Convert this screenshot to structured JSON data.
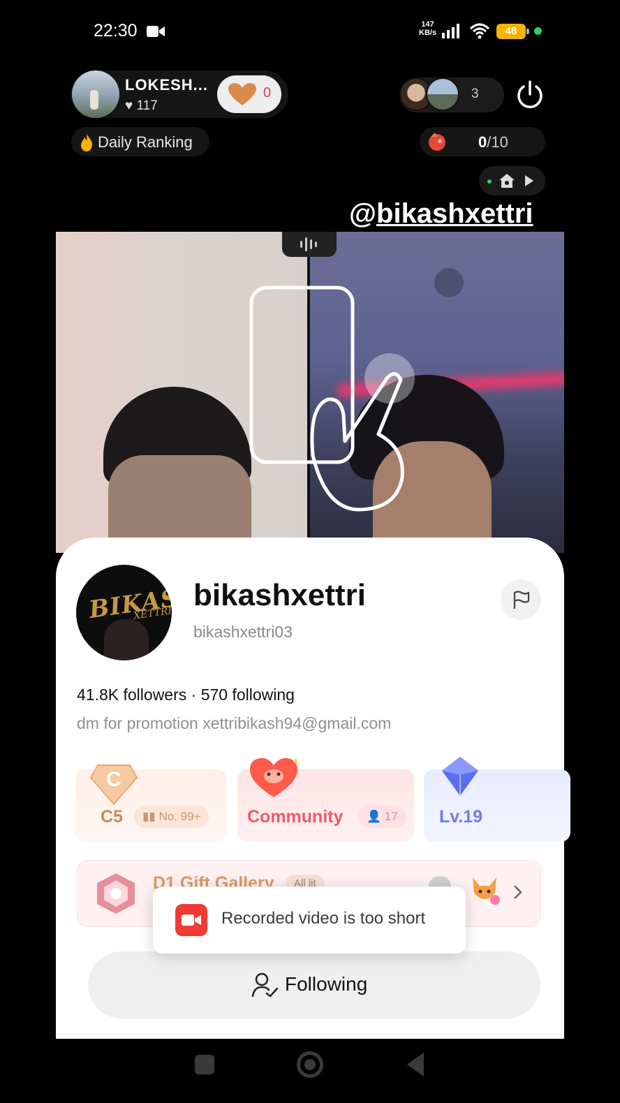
{
  "status_bar": {
    "time": "22:30",
    "net_speed_value": "147",
    "net_speed_unit": "KB/s",
    "battery": "48"
  },
  "host": {
    "name": "LOKESH...",
    "likes": "117",
    "heart_count": "0"
  },
  "viewers": {
    "count": "3"
  },
  "daily_ranking": {
    "label": "Daily Ranking"
  },
  "goal": {
    "current": "0",
    "total": "/10"
  },
  "watermark": {
    "at": "@",
    "name": "bikashxettri"
  },
  "profile": {
    "display_name": "bikashxettri",
    "username": "bikashxettri03",
    "stats": "41.8K followers · 570 following",
    "bio": "dm for promotion  xettribikash94@gmail.com",
    "avatar_logo": "BIKASH",
    "avatar_logo_sub": "XETTRI"
  },
  "badges": {
    "c5": {
      "label": "C5",
      "rank": "No. 99+"
    },
    "community": {
      "label": "Community",
      "count": "17"
    },
    "level": {
      "label": "Lv.19"
    }
  },
  "gallery": {
    "title": "D1 Gift Gallery",
    "pill": "All lit"
  },
  "follow_button": {
    "label": "Following"
  },
  "toast": {
    "message": "Recorded video is too short"
  },
  "colors": {
    "accent_red": "#f03a33",
    "community_pink": "#ee5a6c",
    "level_blue": "#6e7de8",
    "c5_orange": "#c98a58",
    "online_green": "#2bd35a",
    "battery_yellow": "#f4b400"
  },
  "icons": {
    "status": [
      "camera-icon",
      "signal-icon",
      "wifi-icon",
      "battery-icon"
    ],
    "top": [
      "heart-icon",
      "power-icon",
      "fire-icon",
      "goal-icon",
      "home-icon",
      "play-icon"
    ],
    "profile": [
      "flag-icon",
      "diamond-c-icon",
      "heart-mascot-icon",
      "crystal-icon",
      "gift-gallery-icon",
      "chevron-right-icon",
      "person-check-icon"
    ],
    "toast": [
      "video-camera-icon"
    ],
    "nav": [
      "recents-icon",
      "home-circle-icon",
      "back-icon"
    ]
  }
}
